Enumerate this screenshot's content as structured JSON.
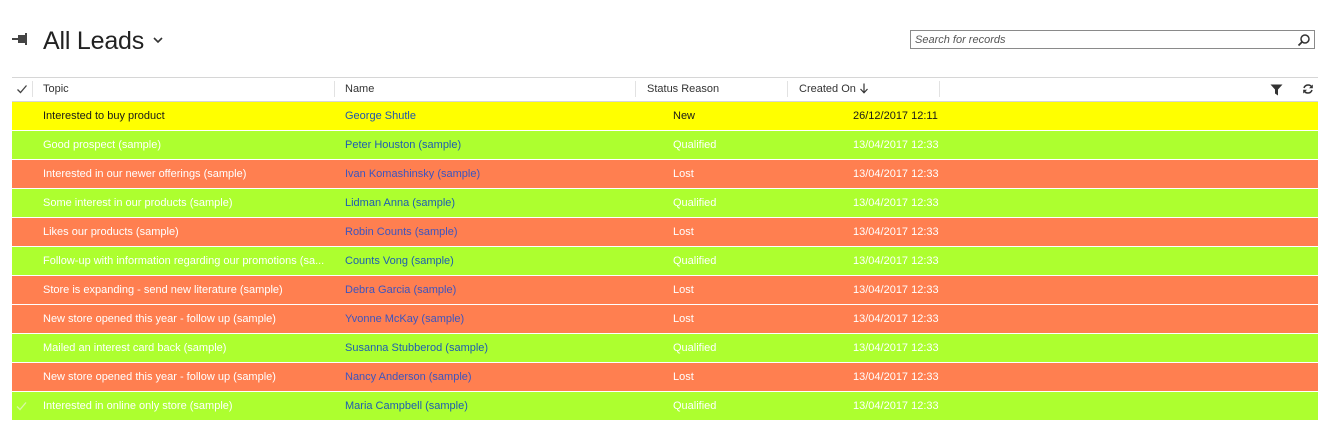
{
  "header": {
    "title": "All Leads",
    "pin_icon": "pin-icon",
    "view_selector_icon": "chevron-down-icon",
    "search": {
      "placeholder": "Search for records",
      "value": "",
      "icon": "search-icon"
    }
  },
  "grid": {
    "columns": {
      "topic": "Topic",
      "name": "Name",
      "status": "Status Reason",
      "created": "Created On"
    },
    "sort": {
      "column": "Created On",
      "direction": "descending"
    },
    "toolbar_icons": [
      "filter-icon",
      "refresh-icon"
    ],
    "rows": [
      {
        "topic": "Interested to buy product",
        "name": "George Shutle",
        "status": "New",
        "created": "26/12/2017 12:11",
        "color": "#ffff00"
      },
      {
        "topic": "Good prospect (sample)",
        "name": "Peter Houston (sample)",
        "status": "Qualified",
        "created": "13/04/2017 12:33",
        "color": "#adff2f"
      },
      {
        "topic": "Interested in our newer offerings (sample)",
        "name": "Ivan Komashinsky (sample)",
        "status": "Lost",
        "created": "13/04/2017 12:33",
        "color": "#ff7f50"
      },
      {
        "topic": "Some interest in our products (sample)",
        "name": "Lidman Anna (sample)",
        "status": "Qualified",
        "created": "13/04/2017 12:33",
        "color": "#adff2f"
      },
      {
        "topic": "Likes our products (sample)",
        "name": "Robin Counts (sample)",
        "status": "Lost",
        "created": "13/04/2017 12:33",
        "color": "#ff7f50"
      },
      {
        "topic": "Follow-up with information regarding our promotions (sa...",
        "name": "Counts Vong (sample)",
        "status": "Qualified",
        "created": "13/04/2017 12:33",
        "color": "#adff2f"
      },
      {
        "topic": "Store is expanding - send new literature (sample)",
        "name": "Debra Garcia (sample)",
        "status": "Lost",
        "created": "13/04/2017 12:33",
        "color": "#ff7f50"
      },
      {
        "topic": "New store opened this year - follow up (sample)",
        "name": "Yvonne McKay (sample)",
        "status": "Lost",
        "created": "13/04/2017 12:33",
        "color": "#ff7f50"
      },
      {
        "topic": "Mailed an interest card back (sample)",
        "name": "Susanna Stubberod (sample)",
        "status": "Qualified",
        "created": "13/04/2017 12:33",
        "color": "#adff2f"
      },
      {
        "topic": "New store opened this year - follow up (sample)",
        "name": "Nancy Anderson (sample)",
        "status": "Lost",
        "created": "13/04/2017 12:33",
        "color": "#ff7f50"
      },
      {
        "topic": "Interested in online only store (sample)",
        "name": "Maria Campbell (sample)",
        "status": "Qualified",
        "created": "13/04/2017 12:33",
        "color": "#adff2f"
      }
    ]
  }
}
